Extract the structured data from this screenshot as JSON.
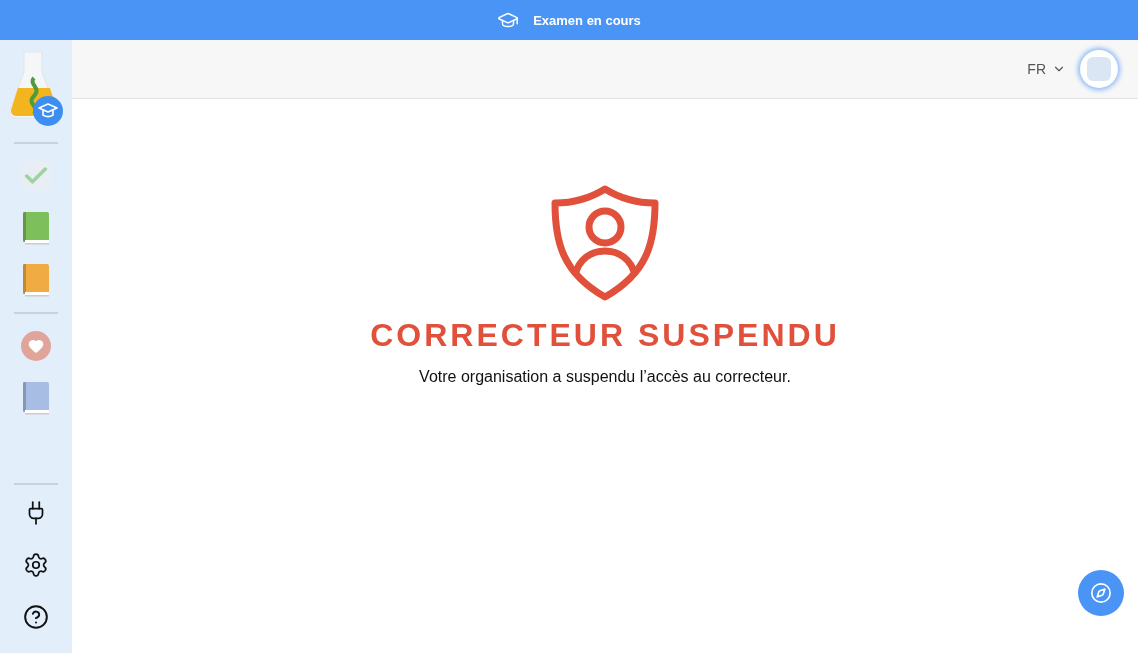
{
  "banner": {
    "text": "Examen en cours"
  },
  "sidebar": {
    "top_items": [
      {
        "kind": "check"
      },
      {
        "kind": "book",
        "color": "#7dbf5a"
      },
      {
        "kind": "book",
        "color": "#f0ac42"
      }
    ],
    "middle_items": [
      {
        "kind": "heart"
      },
      {
        "kind": "book",
        "color": "#a7bde3"
      }
    ],
    "bottom_items": [
      {
        "kind": "plug"
      },
      {
        "kind": "settings"
      },
      {
        "kind": "help"
      }
    ]
  },
  "header": {
    "language": "FR"
  },
  "notice": {
    "title": "CORRECTEUR SUSPENDU",
    "message": "Votre organisation a suspendu l’accès au correcteur."
  }
}
